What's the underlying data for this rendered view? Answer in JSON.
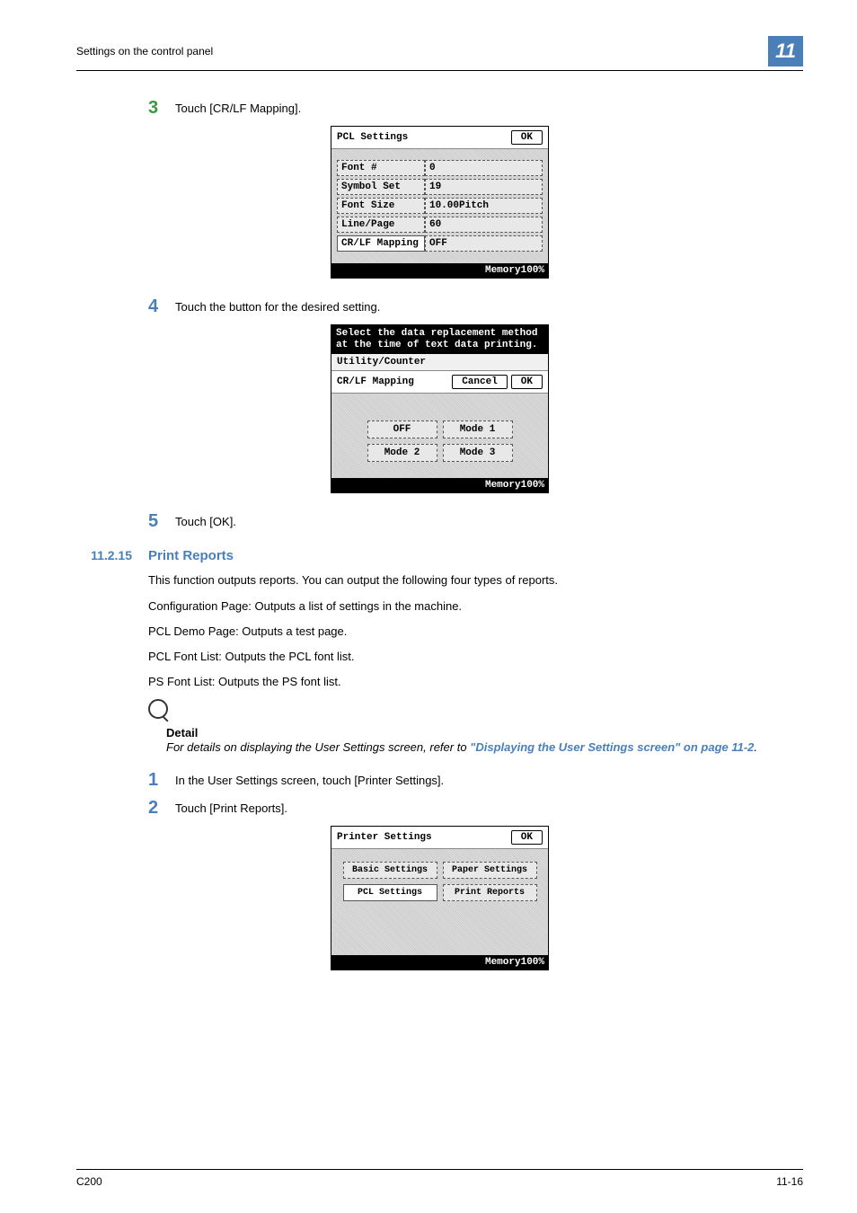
{
  "header": {
    "left": "Settings on the control panel",
    "chapter": "11"
  },
  "step3": {
    "num": "3",
    "text": "Touch [CR/LF Mapping]."
  },
  "lcd1": {
    "title": "PCL Settings",
    "ok": "OK",
    "row1l": "Font #",
    "row1v": "0",
    "row2l": "Symbol Set",
    "row2v": "19",
    "row3l": "Font Size",
    "row3v": "10.00Pitch",
    "row4l": "Line/Page",
    "row4v": "60",
    "row5l": "CR/LF Mapping",
    "row5v": "OFF",
    "footer": "Memory100%"
  },
  "step4": {
    "num": "4",
    "text": "Touch the button for the desired setting."
  },
  "lcd2": {
    "top1": "Select the data replacement method",
    "top2": "at the time of text data printing.",
    "sub": "Utility/Counter",
    "title": "CR/LF Mapping",
    "cancel": "Cancel",
    "ok": "OK",
    "o1": "OFF",
    "o2": "Mode 1",
    "o3": "Mode 2",
    "o4": "Mode 3",
    "footer": "Memory100%"
  },
  "step5": {
    "num": "5",
    "text": "Touch [OK]."
  },
  "section": {
    "num": "11.2.15",
    "title": "Print Reports"
  },
  "p1": "This function outputs reports. You can output the following four types of reports.",
  "p2": "Configuration Page: Outputs a list of settings in the machine.",
  "p3": "PCL Demo Page: Outputs a test page.",
  "p4": "PCL Font List: Outputs the PCL font list.",
  "p5": "PS Font List: Outputs the PS font list.",
  "detail": {
    "title": "Detail",
    "pre": "For details on displaying the User Settings screen, refer to ",
    "link": "\"Displaying the User Settings screen\" on page 11-2",
    "post": "."
  },
  "step1b": {
    "num": "1",
    "text": "In the User Settings screen, touch [Printer Settings]."
  },
  "step2b": {
    "num": "2",
    "text": "Touch [Print Reports]."
  },
  "lcd3": {
    "title": "Printer Settings",
    "ok": "OK",
    "o1": "Basic Settings",
    "o2": "Paper Settings",
    "o3": "PCL Settings",
    "o4": "Print Reports",
    "footer": "Memory100%"
  },
  "footer": {
    "left": "C200",
    "right": "11-16"
  }
}
